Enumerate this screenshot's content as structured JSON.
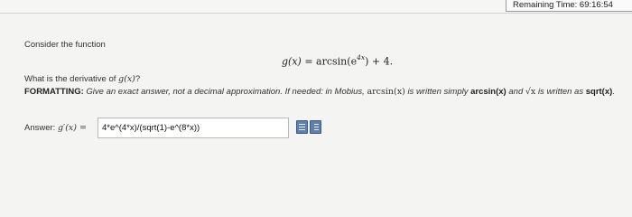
{
  "header": {
    "timer_label": "Remaining Time:",
    "timer_value": "69:16:54"
  },
  "question": {
    "intro": "Consider the function",
    "function_lhs": "g(x)",
    "function_eq": "=",
    "function_rhs_pre": "arcsin(e",
    "function_exp": "4x",
    "function_rhs_post": ") + 4.",
    "prompt_pre": "What is the derivative of",
    "prompt_math": "g(x)",
    "prompt_post": "?",
    "formatting_label": "FORMATTING:",
    "formatting_text_1": "Give an exact answer, not a decimal approximation. If needed: in Mobius,",
    "formatting_math_1": "arcsin(x)",
    "formatting_text_2": "is written simply",
    "formatting_bold_1": "arcsin(x)",
    "formatting_text_3": "and",
    "formatting_math_2": "√x",
    "formatting_text_4": "is written as",
    "formatting_bold_2": "sqrt(x)",
    "formatting_end": "."
  },
  "answer": {
    "label": "Answer:",
    "label_math": "g′(x) =",
    "value": "4*e^(4*x)/(sqrt(1)-e^(8*x))"
  },
  "toolbar": {
    "icons": [
      "equation-editor-icon",
      "preview-icon"
    ]
  }
}
